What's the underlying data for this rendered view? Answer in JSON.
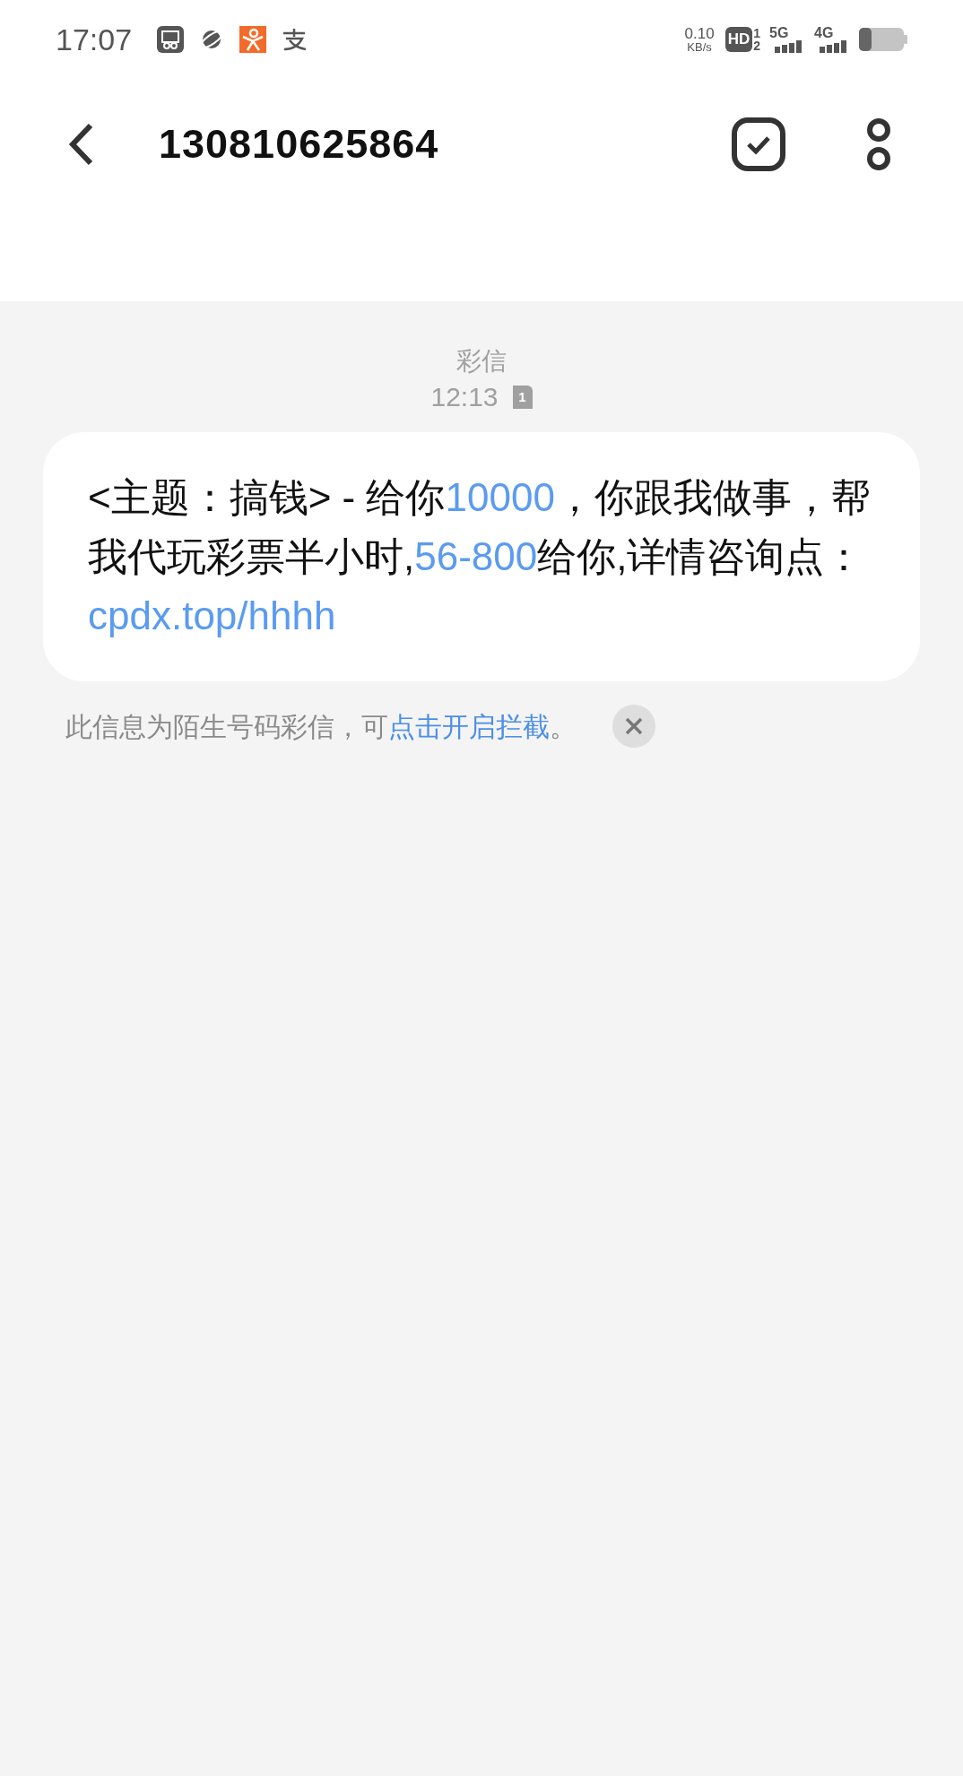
{
  "status_bar": {
    "time": "17:07",
    "speed_value": "0.10",
    "speed_unit": "KB/s",
    "hd_label": "HD",
    "sim_labels": [
      "1",
      "2"
    ],
    "networks": [
      "5G",
      "4G"
    ]
  },
  "header": {
    "title": "130810625864"
  },
  "conversation": {
    "type_label": "彩信",
    "time": "12:13",
    "sim_badge": "1",
    "message": [
      {
        "kind": "text",
        "text": "<主题：搞钱> - 给你"
      },
      {
        "kind": "link",
        "text": "10000"
      },
      {
        "kind": "text",
        "text": "，你跟我做事，帮我代玩彩票半小时,"
      },
      {
        "kind": "link",
        "text": "56-800"
      },
      {
        "kind": "text",
        "text": "给你,详情咨询点："
      },
      {
        "kind": "link",
        "text": "cpdx.top/hhhh"
      }
    ],
    "notice": [
      {
        "kind": "text",
        "text": "此信息为陌生号码彩信，可"
      },
      {
        "kind": "link",
        "text": "点击开启拦截"
      },
      {
        "kind": "text",
        "text": "。"
      }
    ]
  }
}
